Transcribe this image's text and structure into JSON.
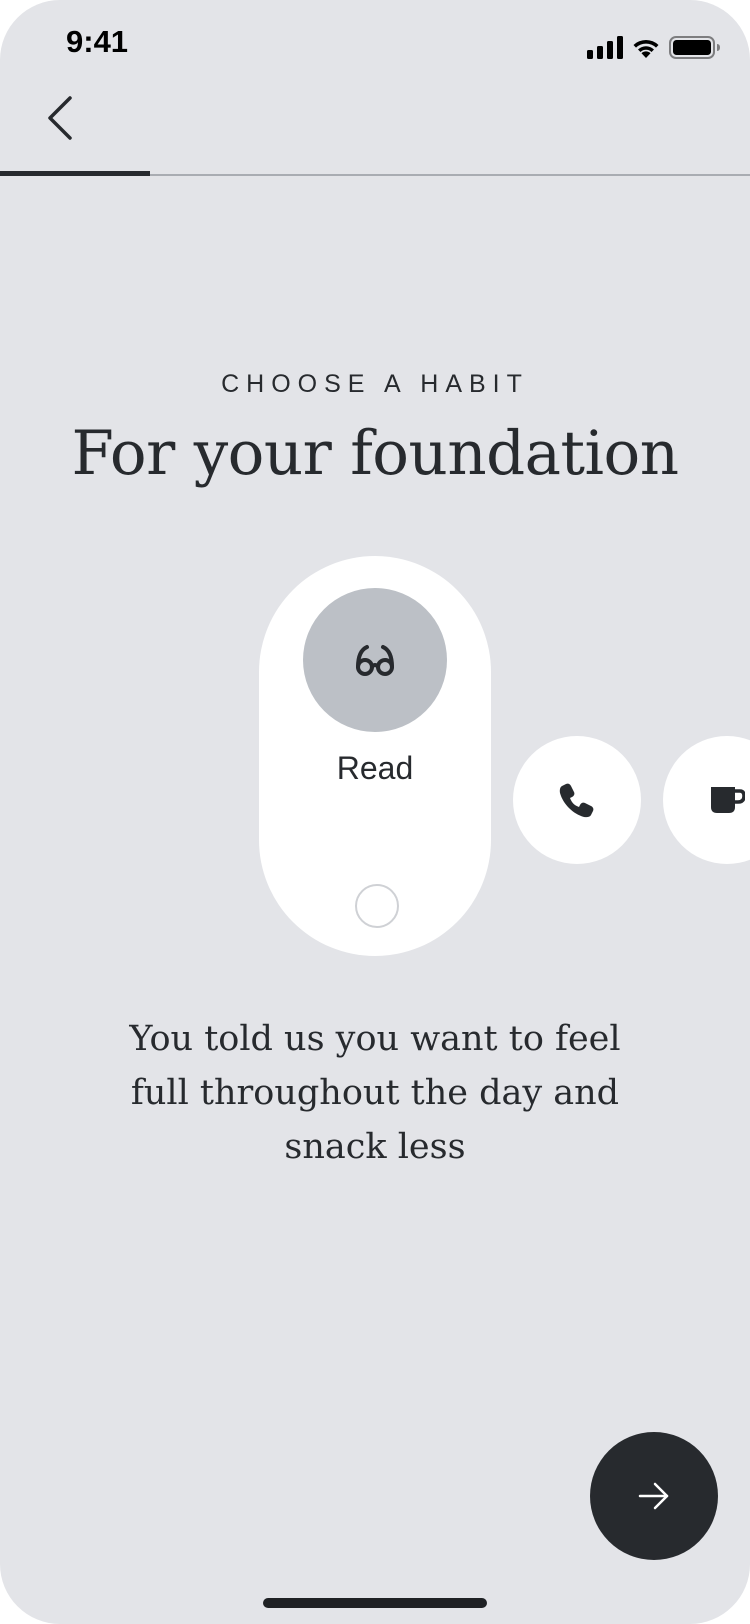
{
  "status_bar": {
    "time": "9:41",
    "icons": [
      "cellular-signal-icon",
      "wifi-icon",
      "battery-icon"
    ]
  },
  "header": {
    "back_icon": "chevron-left-icon",
    "progress_fraction": 0.2
  },
  "content": {
    "eyebrow": "CHOOSE A HABIT",
    "title": "For your foundation",
    "description": "You told us you want to feel full throughout the day and snack less"
  },
  "habits": [
    {
      "label": "Read",
      "icon": "glasses-icon",
      "selected": true,
      "checked": false
    },
    {
      "label": "",
      "icon": "phone-icon",
      "selected": false
    },
    {
      "label": "",
      "icon": "coffee-cup-icon",
      "selected": false
    }
  ],
  "footer": {
    "next_icon": "arrow-right-icon"
  },
  "colors": {
    "background": "#e3e4e8",
    "card": "#ffffff",
    "accent_dark": "#272a2e",
    "icon_circle": "#bcc0c6"
  }
}
